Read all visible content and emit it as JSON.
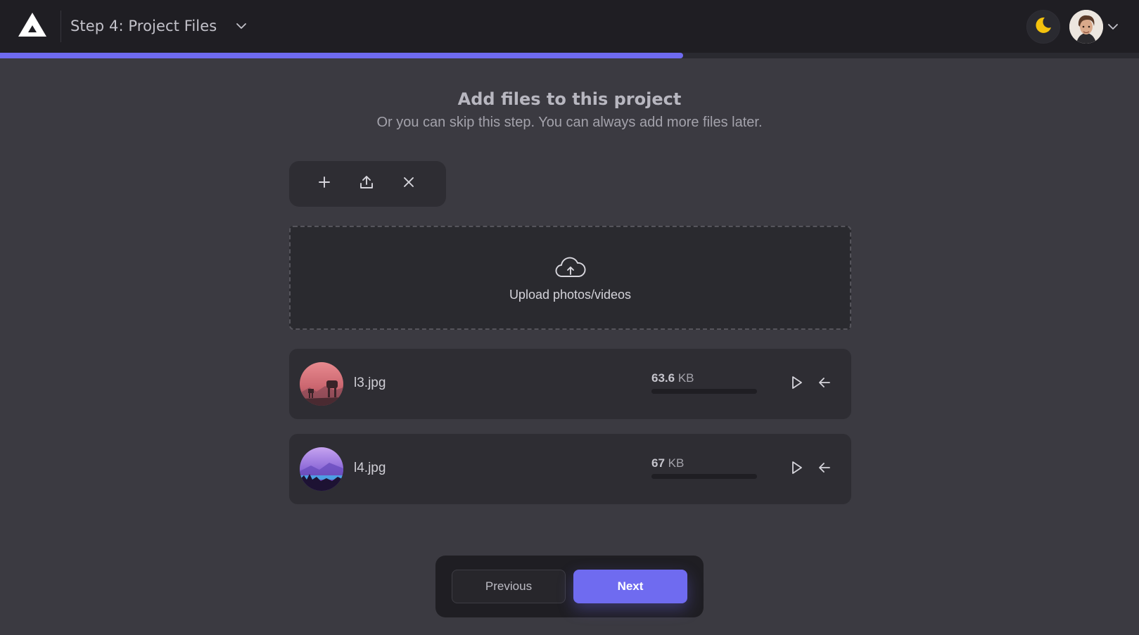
{
  "header": {
    "step_title": "Step 4: Project Files",
    "icons": {
      "logo": "triangle-logo-icon",
      "step_menu": "chevron-down-icon",
      "theme": "moon-icon",
      "user_menu": "chevron-down-icon"
    },
    "user_avatar": "avatar",
    "progress_fraction": 0.6,
    "accent_color": "#6f6bf0"
  },
  "main": {
    "title": "Add files to this project",
    "subtitle": "Or you can skip this step. You can always add more files later.",
    "toolbar": {
      "icons": [
        "plus-icon",
        "upload-icon",
        "close-icon"
      ]
    },
    "dropzone": {
      "icon": "cloud-upload-icon",
      "label": "Upload photos/videos"
    },
    "files": [
      {
        "name": "l3.jpg",
        "size_value": "63.6",
        "size_unit": "KB",
        "progress": 0.0,
        "actions": [
          "play-icon",
          "arrow-left-icon"
        ]
      },
      {
        "name": "l4.jpg",
        "size_value": "67",
        "size_unit": "KB",
        "progress": 0.0,
        "actions": [
          "play-icon",
          "arrow-left-icon"
        ]
      }
    ]
  },
  "footer": {
    "previous_label": "Previous",
    "next_label": "Next"
  }
}
